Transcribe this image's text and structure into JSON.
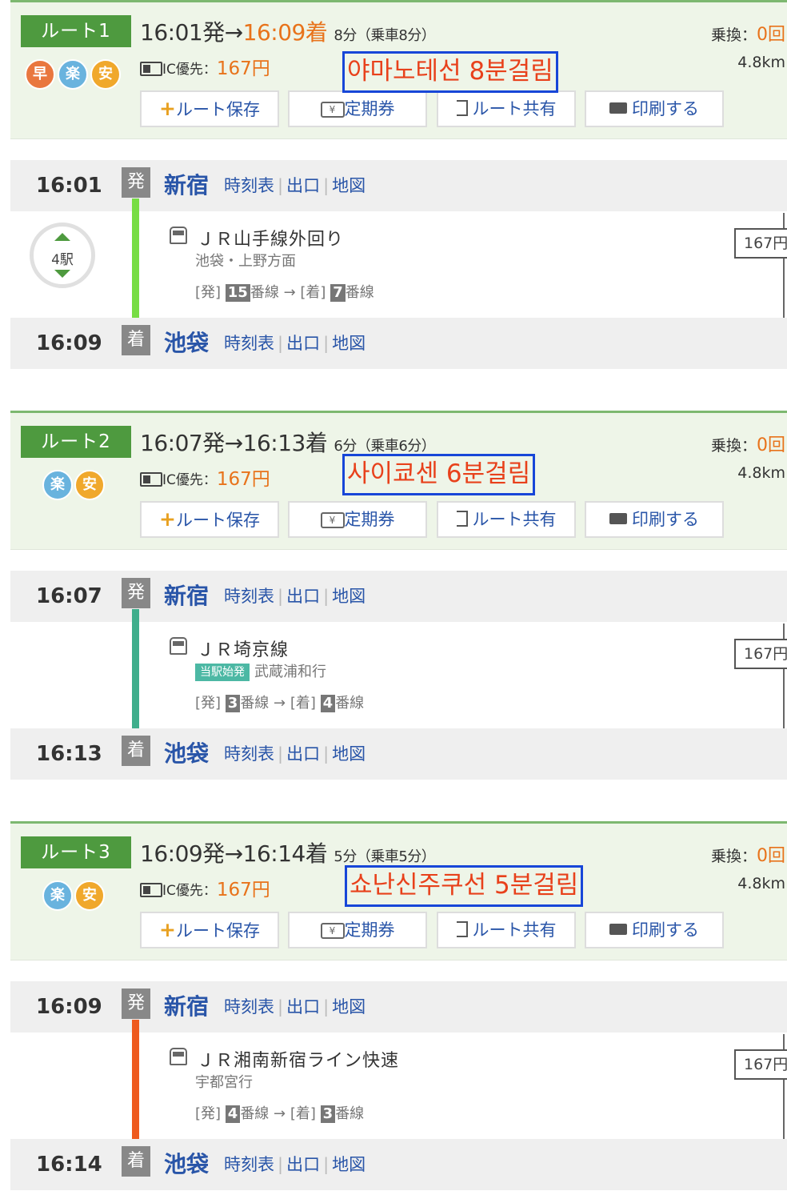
{
  "routes": [
    {
      "label": "ルート1",
      "badges": [
        "早",
        "楽",
        "安"
      ],
      "dep_time": "16:01発",
      "arrow": "→",
      "arr_time": "16:09着",
      "duration": "8分（乗車8分）",
      "ic_label": "IC優先：",
      "fare": "167円",
      "transfer_label": "乗換：",
      "transfer_count": "0回",
      "distance": "4.8km",
      "annotation": "야마노테선 8분걸림",
      "from": {
        "time": "16:01",
        "mark": "発",
        "station": "新宿"
      },
      "to": {
        "time": "16:09",
        "mark": "着",
        "station": "池袋"
      },
      "line_name": "ＪＲ山手線外回り",
      "direction": "池袋・上野方面",
      "start_badge": "",
      "stops": "4駅",
      "dep_platform": "15",
      "arr_platform": "7",
      "segment_fare": "167円",
      "line_color": "#77dd44"
    },
    {
      "label": "ルート2",
      "badges": [
        "楽",
        "安"
      ],
      "dep_time": "16:07発",
      "arrow": "→",
      "arr_time": "16:13着",
      "duration": "6分（乗車6分）",
      "ic_label": "IC優先：",
      "fare": "167円",
      "transfer_label": "乗換：",
      "transfer_count": "0回",
      "distance": "4.8km",
      "annotation": "사이쿄센 6분걸림",
      "from": {
        "time": "16:07",
        "mark": "発",
        "station": "新宿"
      },
      "to": {
        "time": "16:13",
        "mark": "着",
        "station": "池袋"
      },
      "line_name": "ＪＲ埼京線",
      "direction": "武蔵浦和行",
      "start_badge": "当駅始発",
      "stops": "",
      "dep_platform": "3",
      "arr_platform": "4",
      "segment_fare": "167円",
      "line_color": "#3fae8c"
    },
    {
      "label": "ルート3",
      "badges": [
        "楽",
        "安"
      ],
      "dep_time": "16:09発",
      "arrow": "→",
      "arr_time": "16:14着",
      "duration": "5分（乗車5分）",
      "ic_label": "IC優先：",
      "fare": "167円",
      "transfer_label": "乗換：",
      "transfer_count": "0回",
      "distance": "4.8km",
      "annotation": "쇼난신주쿠선 5분걸림",
      "from": {
        "time": "16:09",
        "mark": "発",
        "station": "新宿"
      },
      "to": {
        "time": "16:14",
        "mark": "着",
        "station": "池袋"
      },
      "line_name": "ＪＲ湘南新宿ライン快速",
      "direction": "宇都宮行",
      "start_badge": "",
      "stops": "",
      "dep_platform": "4",
      "arr_platform": "3",
      "segment_fare": "167円",
      "line_color": "#ee5a1e"
    }
  ],
  "buttons": {
    "save": "ルート保存",
    "pass": "定期券",
    "share": "ルート共有",
    "print": "印刷する",
    "yen_icon_text": "¥"
  },
  "station_links": {
    "timetable": "時刻表",
    "exit": "出口",
    "map": "地図"
  },
  "platform_text": {
    "dep_prefix": "[発]",
    "arr_prefix": "[着]",
    "suffix": "番線",
    "arrow": "→"
  },
  "colors": {
    "accent_green": "#4e9a3f",
    "link_blue": "#2955a8",
    "fare_orange": "#e8731b",
    "annotation_red": "#e8411b",
    "annotation_border": "#1746d8"
  }
}
